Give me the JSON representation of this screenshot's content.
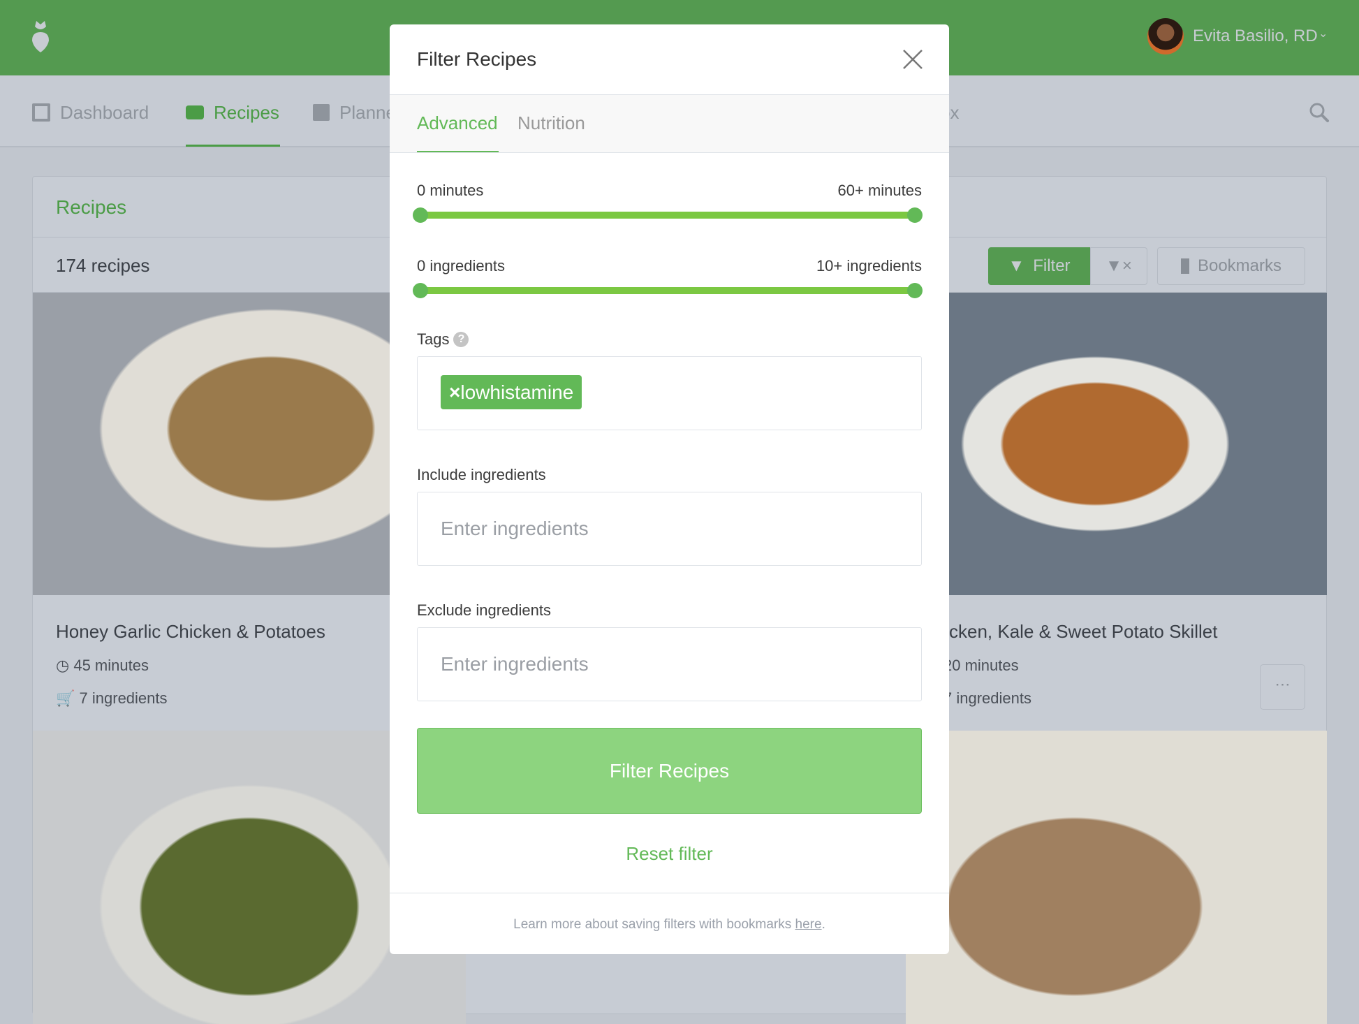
{
  "header": {
    "user_name": "Evita Basilio, RD",
    "logo": "radish-logo-icon"
  },
  "nav": {
    "items": [
      {
        "label": "Dashboard",
        "icon": "dashboard-icon"
      },
      {
        "label": "Recipes",
        "icon": "inbox-icon",
        "active": true
      },
      {
        "label": "Planner",
        "icon": "calendar-icon"
      },
      {
        "label": "ox"
      }
    ],
    "search_icon": "search-icon"
  },
  "panel": {
    "title": "Recipes",
    "count": "174 recipes",
    "filter_label": "Filter",
    "bookmarks_label": "Bookmarks"
  },
  "cards": [
    {
      "title": "Honey Garlic Chicken & Potatoes",
      "time": "45 minutes",
      "ingredients": "7 ingredients"
    },
    {
      "title": "cken, Kale & Sweet Potato Skillet",
      "time": "20 minutes",
      "ingredients": "7 ingredients"
    }
  ],
  "modal": {
    "title": "Filter Recipes",
    "tabs": [
      {
        "label": "Advanced",
        "active": true
      },
      {
        "label": "Nutrition"
      }
    ],
    "time_range": {
      "min_label": "0 minutes",
      "max_label": "60+ minutes",
      "min": 0,
      "max": 60
    },
    "ingredient_range": {
      "min_label": "0 ingredients",
      "max_label": "10+ ingredients",
      "min": 0,
      "max": 10
    },
    "tags_label": "Tags",
    "tags": [
      "lowhistamine"
    ],
    "include_label": "Include ingredients",
    "include_placeholder": "Enter ingredients",
    "exclude_label": "Exclude ingredients",
    "exclude_placeholder": "Enter ingredients",
    "submit_label": "Filter Recipes",
    "reset_label": "Reset filter",
    "footer_text": "Learn more about saving filters with bookmarks ",
    "footer_link": "here",
    "footer_end": "."
  },
  "colors": {
    "brand": "#549a50",
    "accent": "#62b957",
    "button": "#8dd47f"
  }
}
